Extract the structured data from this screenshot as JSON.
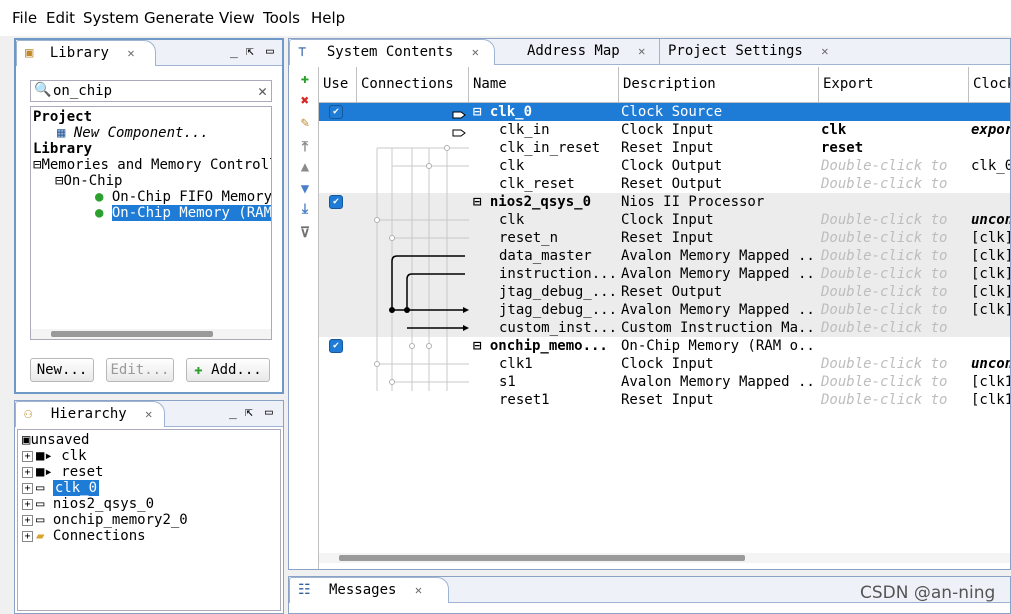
{
  "menu": [
    "File",
    "Edit",
    "System",
    "Generate",
    "View",
    "Tools",
    "Help"
  ],
  "library": {
    "title": "Library",
    "search_value": "on_chip",
    "tree": {
      "project_header": "Project",
      "new_component": "New Component...",
      "library_header": "Library",
      "category": "Memories and Memory Controll",
      "subcategory": "On-Chip",
      "items": [
        "On-Chip FIFO Memory",
        "On-Chip Memory (RAM o"
      ]
    },
    "buttons": {
      "new": "New...",
      "edit": "Edit...",
      "add": "Add..."
    }
  },
  "hierarchy": {
    "title": "Hierarchy",
    "root": "unsaved",
    "items": [
      "clk",
      "reset",
      "clk_0",
      "nios2_qsys_0",
      "onchip_memory2_0",
      "Connections"
    ]
  },
  "tabs": {
    "system_contents": "System Contents",
    "address_map": "Address Map",
    "project_settings": "Project Settings"
  },
  "table": {
    "columns": [
      "Use",
      "Connections",
      "Name",
      "Description",
      "Export",
      "Clock"
    ],
    "rows": [
      {
        "name": "clk_0",
        "desc": "Clock Source",
        "export": "",
        "clock": "",
        "component": true,
        "checked": true,
        "selected": true
      },
      {
        "name": "clk_in",
        "desc": "Clock Input",
        "export": "clk",
        "export_style": "bold",
        "clock": "expor"
      },
      {
        "name": "clk_in_reset",
        "desc": "Reset Input",
        "export": "reset",
        "export_style": "bold",
        "clock": ""
      },
      {
        "name": "clk",
        "desc": "Clock Output",
        "export": "Double-click to",
        "export_style": "hint",
        "clock": "clk_0"
      },
      {
        "name": "clk_reset",
        "desc": "Reset Output",
        "export": "Double-click to",
        "export_style": "hint",
        "clock": ""
      },
      {
        "name": "nios2_qsys_0",
        "desc": "Nios II Processor",
        "export": "",
        "clock": "",
        "component": true,
        "checked": true
      },
      {
        "name": "clk",
        "desc": "Clock Input",
        "export": "Double-click to",
        "export_style": "hint",
        "clock": "uncon"
      },
      {
        "name": "reset_n",
        "desc": "Reset Input",
        "export": "Double-click to",
        "export_style": "hint",
        "clock": "[clk]"
      },
      {
        "name": "data_master",
        "desc": "Avalon Memory Mapped ...",
        "export": "Double-click to",
        "export_style": "hint",
        "clock": "[clk]"
      },
      {
        "name": "instruction...",
        "desc": "Avalon Memory Mapped ...",
        "export": "Double-click to",
        "export_style": "hint",
        "clock": "[clk]"
      },
      {
        "name": "jtag_debug_...",
        "desc": "Reset Output",
        "export": "Double-click to",
        "export_style": "hint",
        "clock": "[clk]"
      },
      {
        "name": "jtag_debug_...",
        "desc": "Avalon Memory Mapped ...",
        "export": "Double-click to",
        "export_style": "hint",
        "clock": "[clk]"
      },
      {
        "name": "custom_inst...",
        "desc": "Custom Instruction Ma...",
        "export": "Double-click to",
        "export_style": "hint",
        "clock": ""
      },
      {
        "name": "onchip_memo...",
        "desc": "On-Chip Memory (RAM o...",
        "export": "",
        "clock": "",
        "component": true,
        "checked": true
      },
      {
        "name": "clk1",
        "desc": "Clock Input",
        "export": "Double-click to",
        "export_style": "hint",
        "clock": "uncon"
      },
      {
        "name": "s1",
        "desc": "Avalon Memory Mapped ...",
        "export": "Double-click to",
        "export_style": "hint",
        "clock": "[clk1]"
      },
      {
        "name": "reset1",
        "desc": "Reset Input",
        "export": "Double-click to",
        "export_style": "hint",
        "clock": "[clk1]"
      }
    ]
  },
  "messages": {
    "title": "Messages"
  },
  "watermark": "CSDN @an-ning",
  "colors": {
    "selection": "#1e7bd6",
    "panel_border": "#6d98c8",
    "hint_text": "#bdbdbd"
  }
}
